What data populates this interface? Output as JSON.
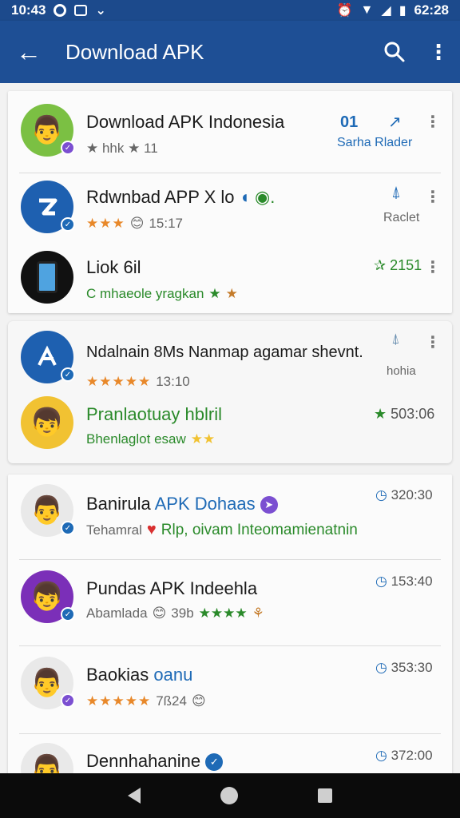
{
  "status_bar": {
    "time": "10:43",
    "clock": "62:28"
  },
  "app_bar": {
    "title": "Download APK",
    "back_icon": "arrow-left-icon",
    "search_icon": "search-icon",
    "more_icon": "more-vert-icon"
  },
  "rows": [
    {
      "title": "Download APK Indonesia",
      "subtitle": "★ hhk ★ 11",
      "right_top": "01",
      "right_bottom": "Sarha  Rlader",
      "avatar_color": "#7bc043",
      "verified_color": "#7b4fd1"
    },
    {
      "title": "Rdwnbad APP X lo",
      "stars": "★★★",
      "subtitle_meta": "15:17",
      "right": "Raclet",
      "avatar_color": "#1e60b0",
      "verified_color": "#1e6ab6"
    },
    {
      "title": "Liok 6il",
      "subtitle": "C mhaeole yragkan",
      "right": "2151",
      "avatar_color": "#111111"
    },
    {
      "title": "Ndalnain 8Ms Nanmap agamar shevnt.",
      "stars": "★★★★★",
      "subtitle_meta": "13:10",
      "right": "hohia",
      "avatar_color": "#1e60b0",
      "verified_color": "#1e6ab6"
    },
    {
      "title": "Pranlaotuay hblril",
      "subtitle": "Bhenlaglot esaw",
      "right": "503:06",
      "avatar_color": "#f1c232"
    },
    {
      "title": "Banirula APK Dohaas",
      "title_blue": "APK Dohaas",
      "subtitle": "Tehamral",
      "subtitle_green": "Rlp, oivam Inteomamienatnin",
      "right": "320:30",
      "avatar_color": "#e9e9e9",
      "verified_color": "#1e6ab6"
    },
    {
      "title": "Pundas  APK Indeehla",
      "subtitle": "Abamlada",
      "subtitle_meta": "39b",
      "right": "153:40",
      "avatar_color": "#7b2fb8",
      "verified_color": "#1e6ab6"
    },
    {
      "title": "Baokias",
      "title_blue": "oanu",
      "stars": "★★★★★",
      "subtitle_meta": "7ß24",
      "right": "353:30",
      "avatar_color": "#e9e9e9",
      "verified_color": "#7b4fd1"
    },
    {
      "title": "Dennhahanine",
      "right": "372:00",
      "avatar_color": "#e9e9e9",
      "verified_color": "#1e6ab6"
    }
  ]
}
